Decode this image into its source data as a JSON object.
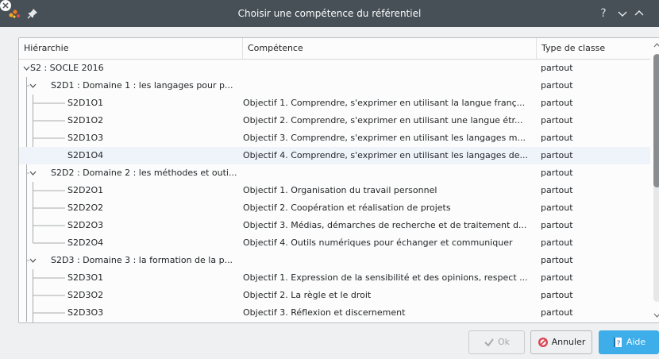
{
  "window": {
    "title": "Choisir une compétence du référentiel",
    "help_glyph": "?"
  },
  "columns": {
    "hierarchy": "Hiérarchie",
    "competence": "Compétence",
    "type": "Type de classe"
  },
  "rows": [
    {
      "level": 0,
      "hier": "S2 : SOCLE 2016",
      "comp": "",
      "type": "partout",
      "expanded": true
    },
    {
      "level": 1,
      "hier": "S2D1 : Domaine 1 : les langages pour p...",
      "comp": "",
      "type": "partout",
      "expanded": true
    },
    {
      "level": 2,
      "hier": "S2D1O1",
      "comp": "Objectif 1. Comprendre, s'exprimer en utilisant la langue franç...",
      "type": "partout"
    },
    {
      "level": 2,
      "hier": "S2D1O2",
      "comp": "Objectif 2. Comprendre, s'exprimer en utilisant une langue étr...",
      "type": "partout"
    },
    {
      "level": 2,
      "hier": "S2D1O3",
      "comp": "Objectif 3. Comprendre, s'exprimer en utilisant les langages m...",
      "type": "partout"
    },
    {
      "level": 2,
      "hier": "S2D1O4",
      "comp": "Objectif 4. Comprendre, s'exprimer en utilisant les langages de...",
      "type": "partout",
      "selected": true
    },
    {
      "level": 1,
      "hier": "S2D2 : Domaine 2 : les méthodes et outi...",
      "comp": "",
      "type": "partout",
      "expanded": true
    },
    {
      "level": 2,
      "hier": "S2D2O1",
      "comp": "Objectif 1. Organisation du travail personnel",
      "type": "partout"
    },
    {
      "level": 2,
      "hier": "S2D2O2",
      "comp": "Objectif 2. Coopération et réalisation de projets",
      "type": "partout"
    },
    {
      "level": 2,
      "hier": "S2D2O3",
      "comp": "Objectif 3. Médias, démarches de recherche et de traitement d...",
      "type": "partout"
    },
    {
      "level": 2,
      "hier": "S2D2O4",
      "comp": "Objectif 4. Outils numériques pour échanger et communiquer",
      "type": "partout"
    },
    {
      "level": 1,
      "hier": "S2D3 : Domaine 3 : la formation de la p...",
      "comp": "",
      "type": "partout",
      "expanded": true
    },
    {
      "level": 2,
      "hier": "S2D3O1",
      "comp": "Objectif 1. Expression de la sensibilité et des opinions, respect ...",
      "type": "partout"
    },
    {
      "level": 2,
      "hier": "S2D3O2",
      "comp": "Objectif 2. La règle et le droit",
      "type": "partout"
    },
    {
      "level": 2,
      "hier": "S2D3O3",
      "comp": "Objectif 3. Réflexion et discernement",
      "type": "partout"
    }
  ],
  "scrollbar": {
    "position_fraction": 0.0,
    "visible_fraction": 0.54
  },
  "buttons": {
    "ok": "Ok",
    "cancel": "Annuler",
    "help": "Aide"
  },
  "colors": {
    "titlebar": "#475057",
    "accent": "#3daee9",
    "cancel_icon": "#da4453",
    "selection": "#eef4fa"
  },
  "icons": {
    "app": "app-icon",
    "pin": "pin-icon",
    "help": "help-icon",
    "minimize": "minimize-icon",
    "maximize": "maximize-icon",
    "close": "close-icon",
    "ok": "checkmark-icon",
    "cancel": "cancel-icon",
    "aide": "help-book-icon"
  }
}
